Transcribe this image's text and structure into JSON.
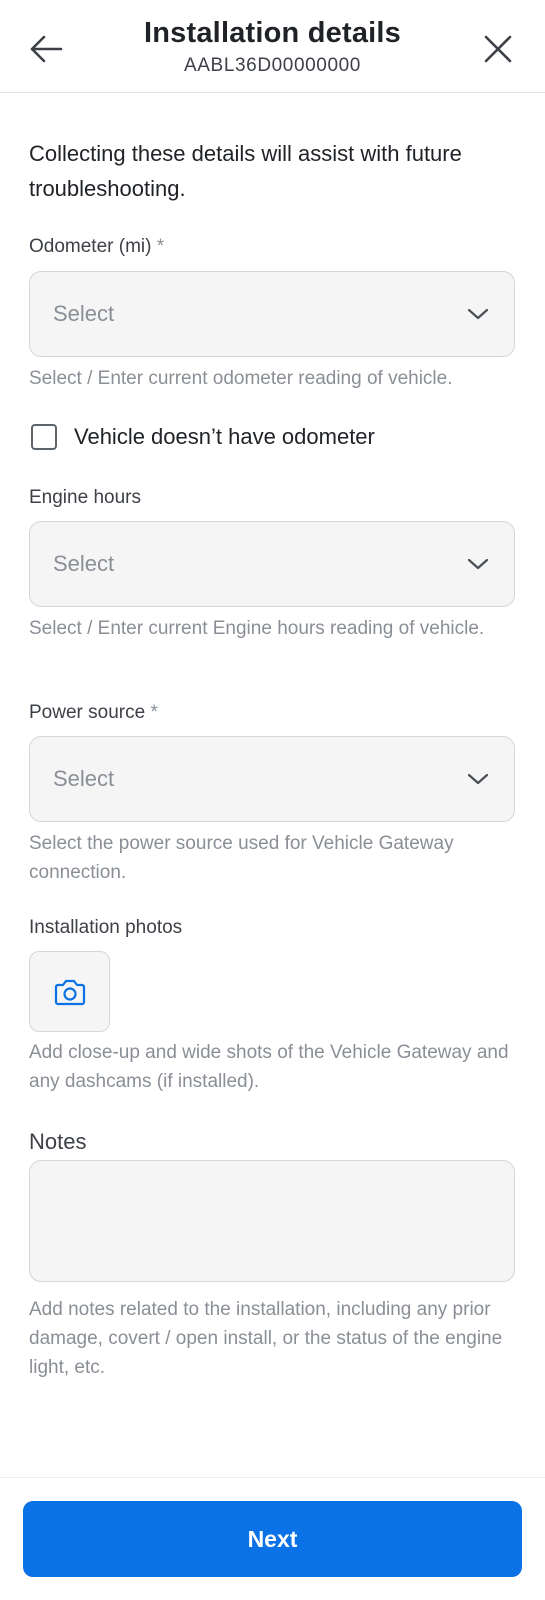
{
  "header": {
    "title": "Installation details",
    "subtitle": "AABL36D00000000",
    "back_icon": "arrow-left-icon",
    "close_icon": "close-icon"
  },
  "intro": "Collecting these details will assist with future troubleshooting.",
  "odometer": {
    "label": "Odometer (mi)",
    "required_mark": "*",
    "placeholder": "Select",
    "helper": "Select / Enter current odometer reading of vehicle."
  },
  "no_odometer": {
    "label": "Vehicle doesn’t have odometer",
    "checked": false
  },
  "engine_hours": {
    "label": "Engine hours",
    "placeholder": "Select",
    "helper": "Select / Enter current Engine hours reading of vehicle."
  },
  "power_source": {
    "label": "Power source",
    "required_mark": "*",
    "placeholder": "Select",
    "helper": "Select the power source used for Vehicle Gateway connection."
  },
  "photos": {
    "label": "Installation photos",
    "icon": "camera-icon",
    "helper": "Add close-up and wide shots of the Vehicle Gateway and any dashcams (if installed)."
  },
  "notes": {
    "label": "Notes",
    "value": "",
    "helper": "Add notes related to the installation, including any prior damage, covert / open install, or the status of the engine light, etc."
  },
  "footer": {
    "next_label": "Next"
  },
  "colors": {
    "accent": "#0a71e6",
    "field_bg": "#f5f5f6",
    "field_border": "#d3d6da",
    "helper_text": "#8a8f96"
  }
}
